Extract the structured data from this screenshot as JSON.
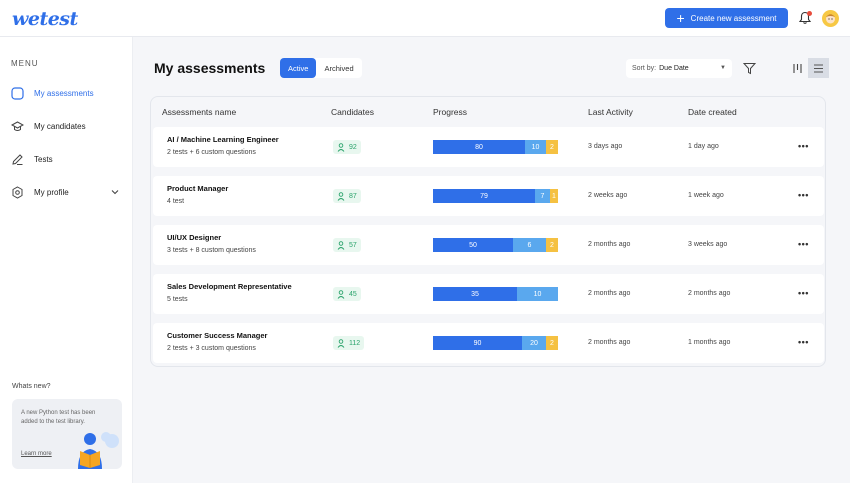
{
  "brand": {
    "logo": "wetest",
    "accent": "#2f6fe8"
  },
  "header": {
    "create_label": "Create new assessment"
  },
  "sidebar": {
    "menu_label": "MENU",
    "items": [
      {
        "label": "My assessments",
        "icon": "square-icon"
      },
      {
        "label": "My candidates",
        "icon": "graduation-cap-icon"
      },
      {
        "label": "Tests",
        "icon": "pencil-icon"
      },
      {
        "label": "My profile",
        "icon": "gear-icon"
      }
    ],
    "whats_new": "Whats new?",
    "promo_text": "A new Python test has been added to the test library.",
    "promo_link": "Learn more"
  },
  "main": {
    "title": "My assessments",
    "tabs": [
      "Active",
      "Archived"
    ],
    "sort_label": "Sort by:",
    "sort_value": "Due Date"
  },
  "table": {
    "headers": [
      "Assessments name",
      "Candidates",
      "Progress",
      "Last Activity",
      "Date created"
    ],
    "rows": [
      {
        "name": "AI / Machine Learning Engineer",
        "sub": "2 tests + 6 custom questions",
        "candidates": "92",
        "progress": [
          "80",
          "10",
          "2"
        ],
        "last": "3 days ago",
        "created": "1 day ago"
      },
      {
        "name": "Product Manager",
        "sub": "4 test",
        "candidates": "87",
        "progress": [
          "79",
          "7",
          "1"
        ],
        "last": "2 weeks ago",
        "created": "1 week ago"
      },
      {
        "name": "UI/UX Designer",
        "sub": "3 tests + 8 custom questions",
        "candidates": "57",
        "progress": [
          "50",
          "6",
          "2"
        ],
        "last": "2 months ago",
        "created": "3 weeks ago"
      },
      {
        "name": "Sales Development Representative",
        "sub": "5 tests",
        "candidates": "45",
        "progress": [
          "35",
          "10",
          ""
        ],
        "last": "2 months ago",
        "created": "2 months ago"
      },
      {
        "name": "Customer Success Manager",
        "sub": "2 tests + 3 custom questions",
        "candidates": "112",
        "progress": [
          "90",
          "20",
          "2"
        ],
        "last": "2 months ago",
        "created": "1 months ago"
      }
    ]
  }
}
